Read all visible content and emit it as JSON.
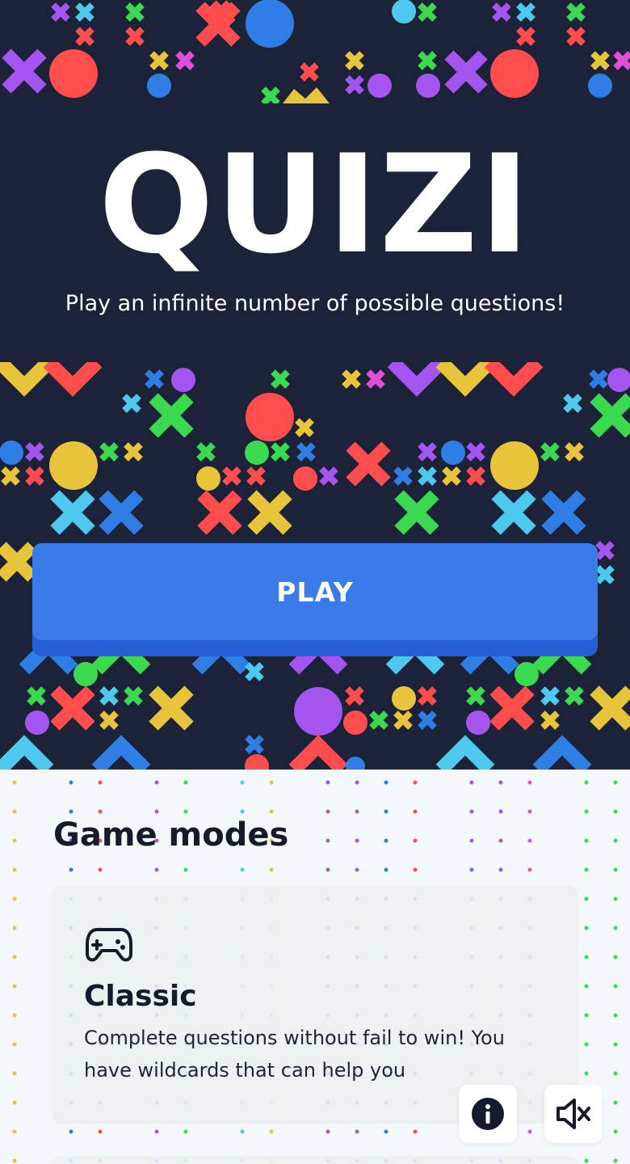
{
  "app": {
    "title": "QUIZI",
    "tagline": "Play an infinite number of possible questions!"
  },
  "actions": {
    "play_label": "PLAY"
  },
  "game_modes": {
    "heading": "Game modes",
    "modes": [
      {
        "name": "Classic",
        "description": "Complete questions without fail to win! You have wildcards that can help you",
        "icon": "gamepad-icon"
      }
    ]
  },
  "floating_buttons": [
    {
      "icon": "info-icon"
    },
    {
      "icon": "sound-muted-icon"
    }
  ],
  "theme": {
    "background_dark": "#1c2237",
    "background_light": "#f3f8fa",
    "play_button": "#3a7bea",
    "play_button_shadow": "#255ed6",
    "palette": [
      "#ff4d4d",
      "#e8c43a",
      "#3ad94f",
      "#a455f0",
      "#2f7ee6",
      "#4dc9ef"
    ]
  }
}
